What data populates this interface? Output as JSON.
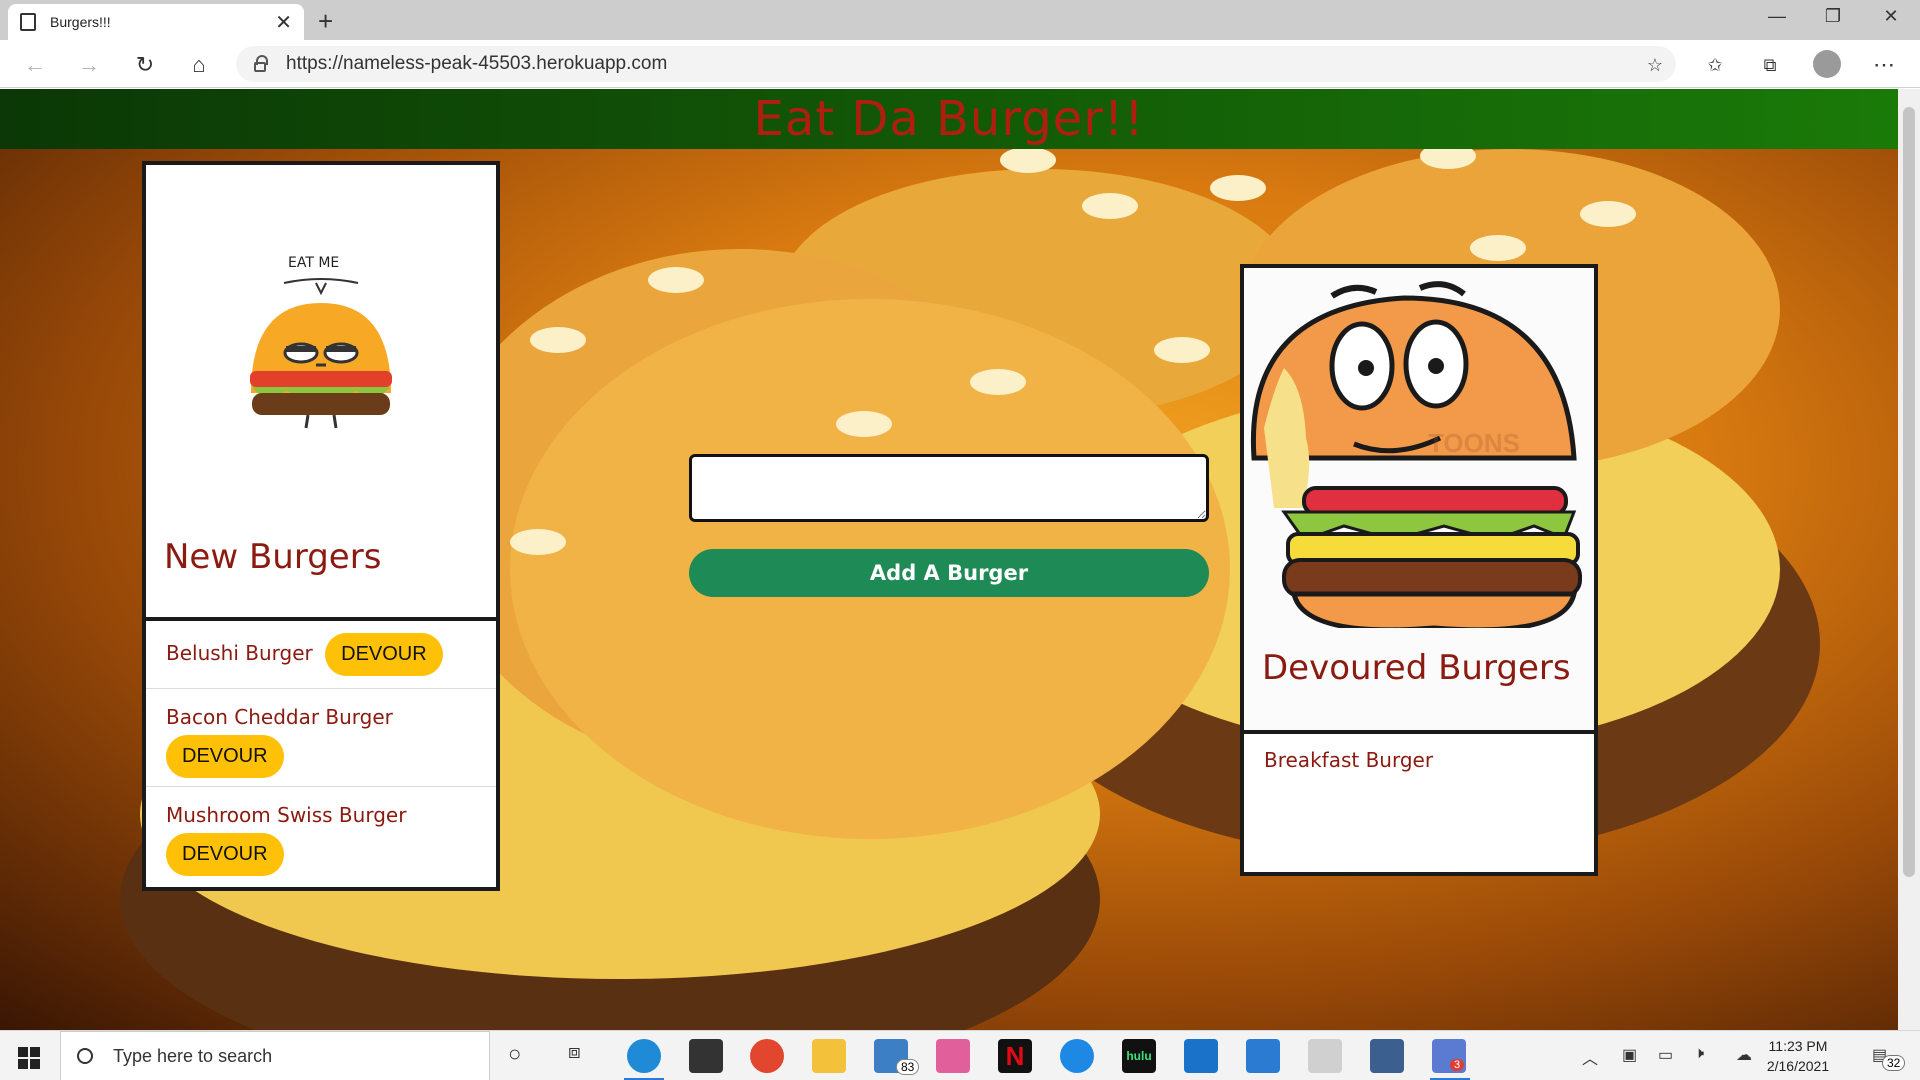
{
  "browser": {
    "tab_title": "Burgers!!!",
    "new_tab_symbol": "+",
    "url": "https://nameless-peak-45503.herokuapp.com"
  },
  "page": {
    "header_title": "Eat Da Burger!!",
    "new_burgers": {
      "heading": "New Burgers",
      "image_caption": "EAT ME",
      "items": [
        {
          "name": "Belushi Burger",
          "button": "DEVOUR"
        },
        {
          "name": "Bacon Cheddar Burger",
          "button": "DEVOUR"
        },
        {
          "name": "Mushroom Swiss Burger",
          "button": "DEVOUR"
        }
      ]
    },
    "form": {
      "input_value": "",
      "button_label": "Add A Burger"
    },
    "devoured_burgers": {
      "heading": "Devoured Burgers",
      "watermark": "TOONS",
      "items": [
        {
          "name": "Breakfast Burger"
        }
      ]
    }
  },
  "taskbar": {
    "search_placeholder": "Type here to search",
    "mail_badge": "83",
    "app_badge": "3",
    "notification_count": "32",
    "time": "11:23 PM",
    "date": "2/16/2021",
    "hulu_label": "hulu"
  },
  "colors": {
    "header_green": "#1a7a08",
    "title_red": "#b01e10",
    "heading_red": "#8b1a10",
    "devour_yellow": "#ffc107",
    "add_button_green": "#1e8a55"
  }
}
